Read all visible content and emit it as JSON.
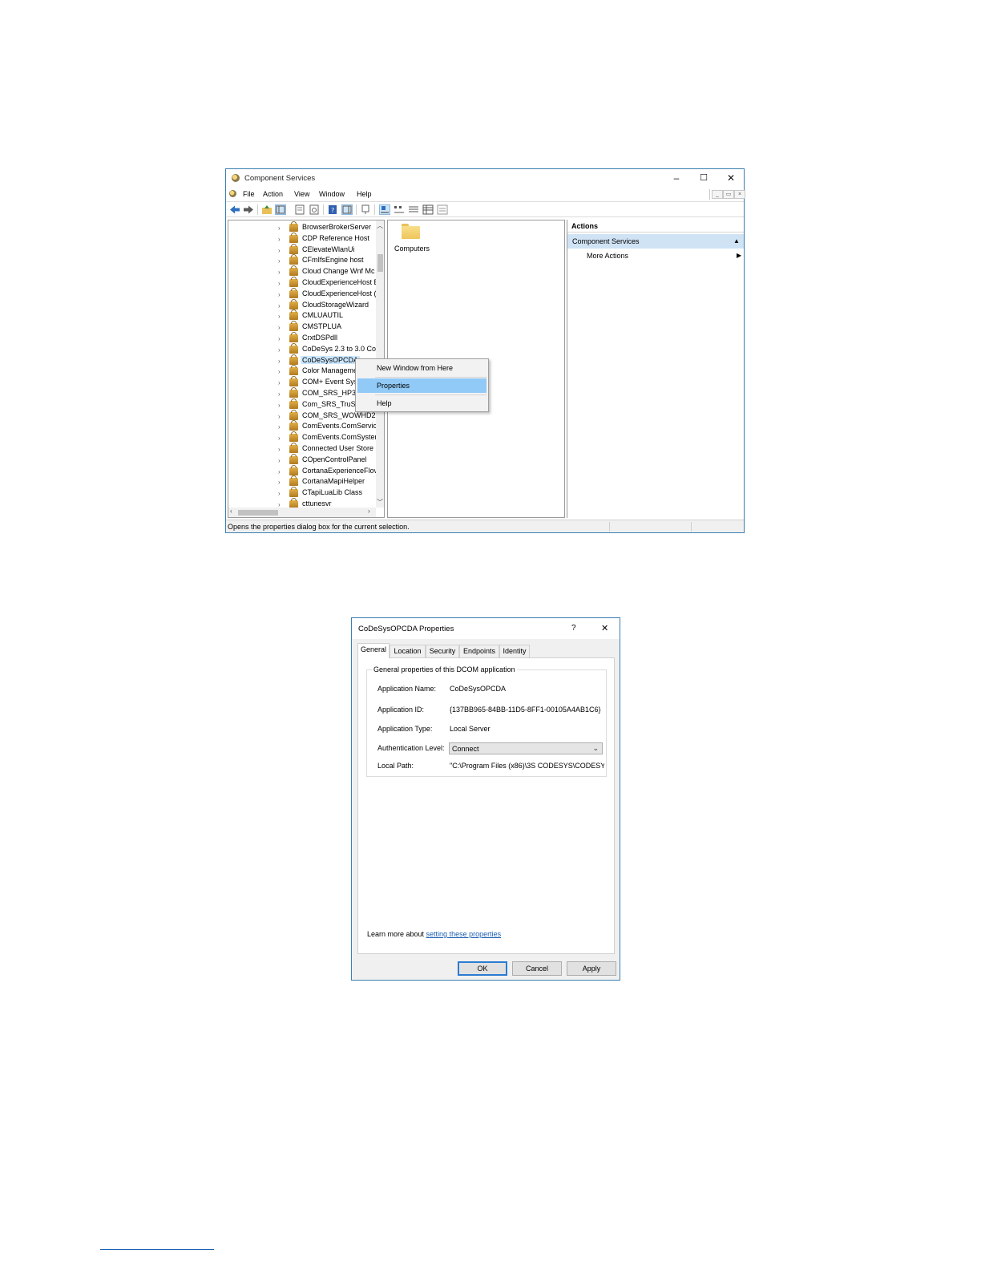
{
  "cs_window": {
    "title": "Component Services",
    "controls": {
      "minimize": "–",
      "maximize": "☐",
      "close": "✕"
    },
    "menu": [
      "File",
      "Action",
      "View",
      "Window",
      "Help"
    ],
    "tree_items": [
      "BrowserBrokerServer",
      "CDP Reference Host",
      "CElevateWlanUi",
      "CFmIfsEngine host",
      "Cloud Change Wnf Mc",
      "CloudExperienceHost E",
      "CloudExperienceHost (",
      "CloudStorageWizard",
      "CMLUAUTIL",
      "CMSTPLUA",
      "CrxtDSPdll",
      "CoDeSys 2.3 to 3.0 Con",
      "CoDeSysOPCDA",
      "Color Manageme",
      "COM+ Event Sys",
      "COM_SRS_HP360",
      "Com_SRS_TruSur",
      "COM_SRS_WOWHD2",
      "ComEvents.ComServic",
      "ComEvents.ComSyster",
      "Connected User Store",
      "COpenControlPanel",
      "CortanaExperienceFlov",
      "CortanaMapiHelper",
      "CTapiLuaLib Class",
      "cttunesvr"
    ],
    "selected_tree_item": "CoDeSysOPCDA",
    "middle_pane": {
      "folder_label": "Computers"
    },
    "actions": {
      "header": "Actions",
      "section": "Component Services",
      "more_actions": "More Actions"
    },
    "status_text": "Opens the properties dialog box for the current selection.",
    "context_menu": {
      "items": [
        "New Window from Here",
        "Properties",
        "Help"
      ],
      "highlighted": "Properties"
    }
  },
  "props_dialog": {
    "title": "CoDeSysOPCDA Properties",
    "help_glyph": "?",
    "close_glyph": "✕",
    "tabs": [
      "General",
      "Location",
      "Security",
      "Endpoints",
      "Identity"
    ],
    "active_tab": "General",
    "group_title": "General properties of this DCOM application",
    "fields": [
      {
        "label": "Application Name:",
        "value": "CoDeSysOPCDA"
      },
      {
        "label": "Application ID:",
        "value": "{137BB965-84BB-11D5-8FF1-00105A4AB1C6}"
      },
      {
        "label": "Application Type:",
        "value": "Local Server"
      },
      {
        "label": "Authentication Level:",
        "value": "Connect"
      },
      {
        "label": "Local Path:",
        "value": "\"C:\\Program Files (x86)\\3S CODESYS\\CODESY"
      }
    ],
    "learn_more_prefix": "Learn more about ",
    "learn_more_link": "setting these properties",
    "buttons": {
      "ok": "OK",
      "cancel": "Cancel",
      "apply": "Apply"
    }
  },
  "colors": {
    "window_border": "#3c7fb1",
    "menu_highlight": "#91c9f7",
    "actions_section": "#cfe3f5",
    "link": "#1a5fb4"
  }
}
